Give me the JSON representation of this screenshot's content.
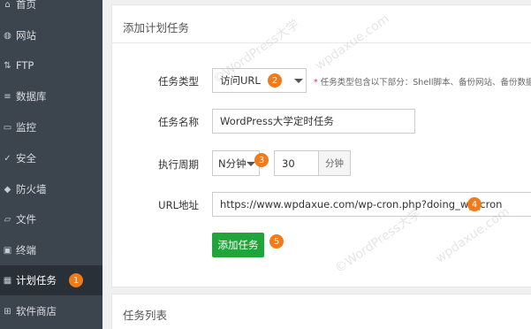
{
  "sidebar": {
    "items": [
      {
        "label": "首页",
        "icon": "home-icon"
      },
      {
        "label": "网站",
        "icon": "globe-icon"
      },
      {
        "label": "FTP",
        "icon": "ftp-icon"
      },
      {
        "label": "数据库",
        "icon": "database-icon"
      },
      {
        "label": "监控",
        "icon": "monitor-icon"
      },
      {
        "label": "安全",
        "icon": "shield-check-icon"
      },
      {
        "label": "防火墙",
        "icon": "firewall-icon"
      },
      {
        "label": "文件",
        "icon": "folder-icon"
      },
      {
        "label": "终端",
        "icon": "terminal-icon"
      },
      {
        "label": "计划任务",
        "icon": "calendar-icon",
        "active": true,
        "badge": "1"
      },
      {
        "label": "软件商店",
        "icon": "grid-icon"
      }
    ]
  },
  "form": {
    "title": "添加计划任务",
    "task_type_label": "任务类型",
    "task_type_value": "访问URL",
    "task_type_badge": "2",
    "task_type_note_star": "*",
    "task_type_note": "任务类型包含以下部分：Shell脚本、备份网站、备份数据库",
    "task_name_label": "任务名称",
    "task_name_value": "WordPress大学定时任务",
    "period_label": "执行周期",
    "period_value": "N分钟",
    "period_badge": "3",
    "period_number": "30",
    "period_unit": "分钟",
    "url_label": "URL地址",
    "url_value": "https://www.wpdaxue.com/wp-cron.php?doing_wp_cron",
    "url_badge": "4",
    "submit_label": "添加任务",
    "submit_badge": "5"
  },
  "task_list": {
    "title": "任务列表"
  },
  "watermark": {
    "line1": "©WordPress大学",
    "line2": "wpdaxue.com"
  },
  "colors": {
    "sidebar_bg": "#3c444d",
    "active_bg": "#293038",
    "badge": "#f07b1b",
    "primary_green": "#20a53a"
  }
}
